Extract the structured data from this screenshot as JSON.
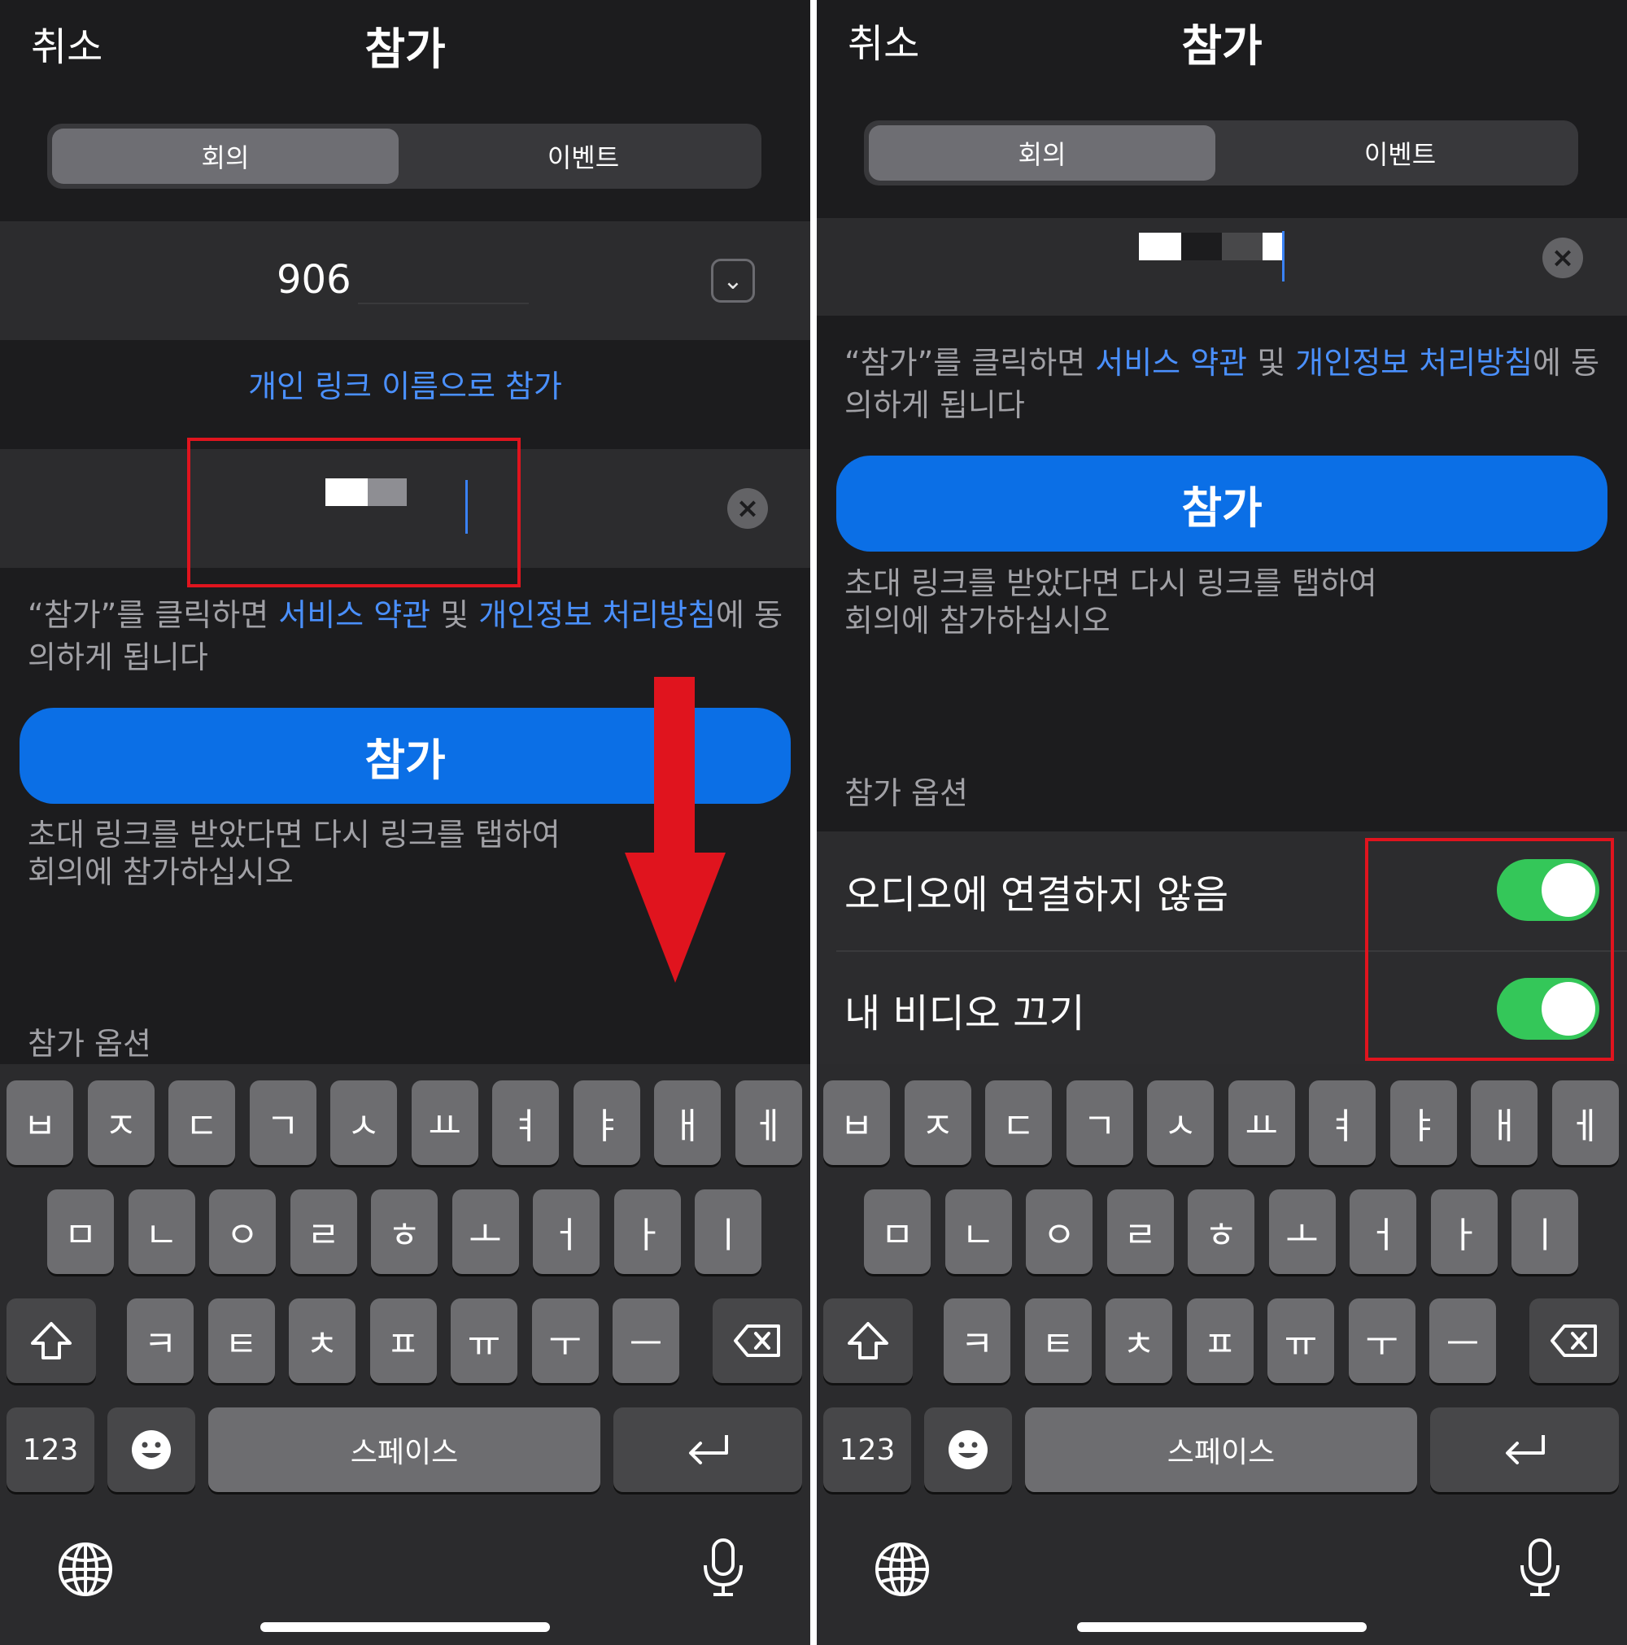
{
  "nav": {
    "cancel": "취소",
    "title": "참가"
  },
  "tabs": [
    {
      "label": "회의",
      "selected": true
    },
    {
      "label": "이벤트",
      "selected": false
    }
  ],
  "meeting_id": {
    "visible_value": "906"
  },
  "personal_link_label": "개인 링크 이름으로 참가",
  "terms": {
    "prefix": "“참가”를 클릭하면 ",
    "service_terms": "서비스 약관",
    "and": " 및 ",
    "privacy_policy": "개인정보 처리방침",
    "suffix": "에 동의하게 됩니다"
  },
  "join_button": "참가",
  "invite_hint_line1": "초대 링크를 받았다면 다시 링크를 탭하여",
  "invite_hint_line2": "회의에 참가하십시오",
  "options": {
    "section_title": "참가 옵션",
    "items": [
      {
        "label": "오디오에 연결하지 않음",
        "on": true
      },
      {
        "label": "내 비디오 끄기",
        "on": true
      }
    ]
  },
  "keyboard": {
    "row1": [
      "ㅂ",
      "ㅈ",
      "ㄷ",
      "ㄱ",
      "ㅅ",
      "ㅛ",
      "ㅕ",
      "ㅑ",
      "ㅐ",
      "ㅔ"
    ],
    "row2": [
      "ㅁ",
      "ㄴ",
      "ㅇ",
      "ㄹ",
      "ㅎ",
      "ㅗ",
      "ㅓ",
      "ㅏ",
      "ㅣ"
    ],
    "row3": [
      "ㅋ",
      "ㅌ",
      "ㅊ",
      "ㅍ",
      "ㅠ",
      "ㅜ",
      "ㅡ"
    ],
    "numbers": "123",
    "space": "스페이스",
    "icons": {
      "shift": "shift-icon",
      "backspace": "backspace-icon",
      "emoji": "emoji-icon",
      "return": "return-icon",
      "globe": "globe-icon",
      "mic": "microphone-icon"
    }
  },
  "colors": {
    "accent": "#0b6fe6",
    "link": "#4a90ff",
    "toggle_on": "#34c759",
    "highlight": "#e0141e"
  }
}
